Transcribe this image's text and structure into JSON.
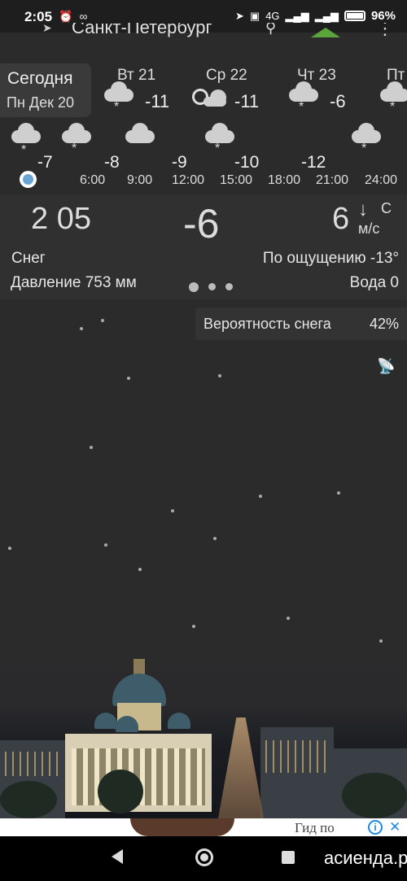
{
  "status": {
    "time": "2:05",
    "network": "4G",
    "battery": "96%"
  },
  "appbar": {
    "city": "Санкт-Петербург"
  },
  "today": {
    "label": "Сегодня",
    "date": "Пн Дек 20"
  },
  "days": [
    {
      "name": "Вт 21",
      "temp": "-11",
      "icon": "cloud-snow-icon"
    },
    {
      "name": "Ср 22",
      "temp": "-11",
      "icon": "sun-cloud-icon"
    },
    {
      "name": "Чт 23",
      "temp": "-6",
      "icon": "cloud-snow-icon"
    },
    {
      "name": "Пт",
      "temp": "",
      "icon": "cloud-snow-icon"
    }
  ],
  "hourly": {
    "temps": [
      "-7",
      "-8",
      "-9",
      "-10",
      "-12"
    ],
    "times": [
      "6:00",
      "9:00",
      "12:00",
      "15:00",
      "18:00",
      "21:00",
      "24:00"
    ]
  },
  "current": {
    "time": "2 05",
    "temp": "-6",
    "wind_speed": "6",
    "wind_dir": "С",
    "wind_unit": "м/с",
    "condition": "Снег",
    "feels_like": "По ощущению -13°",
    "pressure": "Давление 753 мм",
    "water": "Вода 0"
  },
  "precip": {
    "label": "Вероятность снега",
    "value": "42%"
  },
  "ad": {
    "text": "Гид по"
  },
  "watermark": "асиенда.ру"
}
